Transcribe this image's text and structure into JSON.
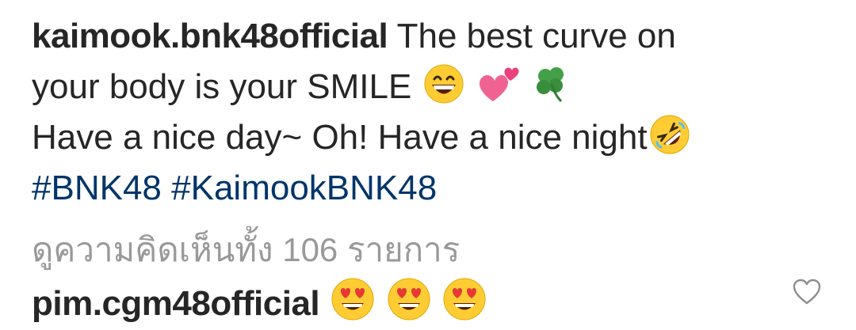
{
  "post": {
    "username": "kaimook.bnk48official",
    "caption_line1": "The best curve on",
    "caption_line2": "your body is your SMILE",
    "caption_line2_emojis": [
      "grinning-face",
      "two-hearts",
      "four-leaf-clover"
    ],
    "caption_line3": "Have a nice day~ Oh! Have a nice night",
    "caption_line3_emoji": "rolling-on-floor-laughing",
    "hashtags": [
      "#BNK48",
      "#KaimookBNK48"
    ]
  },
  "comments_link": {
    "label": "ดูความคิดเห็นทั้ง 106 รายการ"
  },
  "comment": {
    "username": "pim.cgm48official",
    "emojis": [
      "heart-eyes",
      "heart-eyes",
      "heart-eyes"
    ],
    "like_icon": "heart-outline-icon"
  },
  "colors": {
    "text": "#262626",
    "hashtag": "#003569",
    "muted": "#999999",
    "background": "#ffffff"
  }
}
